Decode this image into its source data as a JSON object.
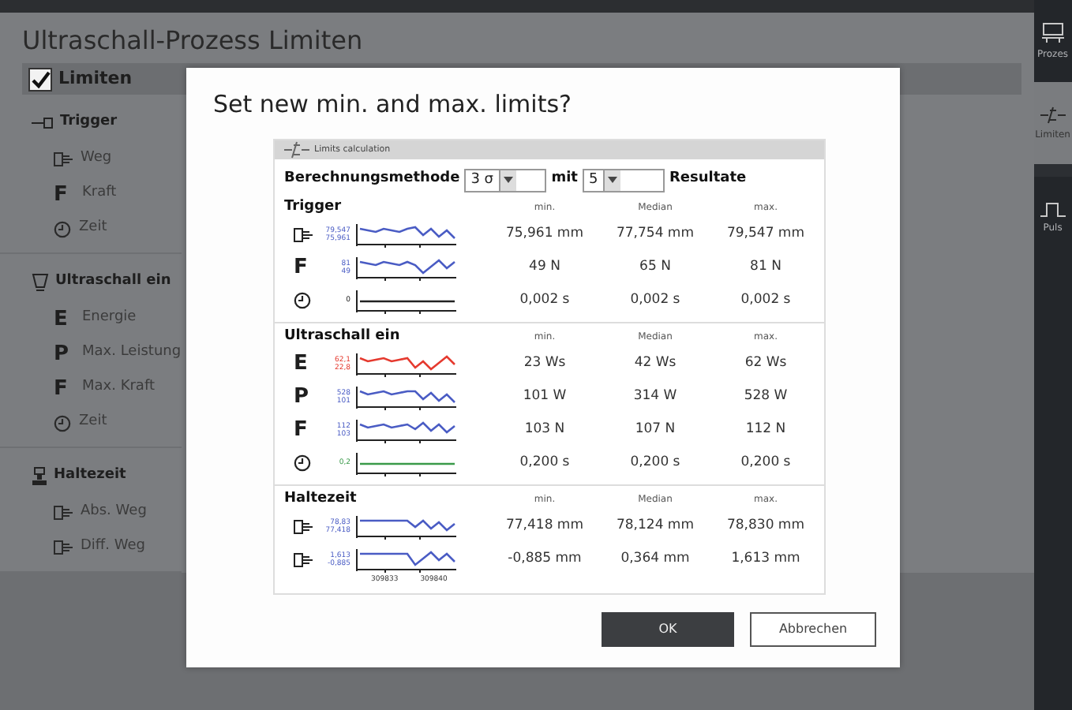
{
  "app": {
    "title": "Ultraschall-Prozess Limiten"
  },
  "sidebar": {
    "header": {
      "label": "Limiten",
      "checked": true
    },
    "sections": [
      {
        "title": "Trigger",
        "items": [
          {
            "label": "Weg",
            "kind": "distance"
          },
          {
            "label": "Kraft",
            "kind": "glyph",
            "glyph": "F"
          },
          {
            "label": "Zeit",
            "kind": "time"
          }
        ]
      },
      {
        "title": "Ultraschall ein",
        "items": [
          {
            "label": "Energie",
            "kind": "glyph",
            "glyph": "E"
          },
          {
            "label": "Max. Leistung",
            "kind": "glyph",
            "glyph": "P"
          },
          {
            "label": "Max. Kraft",
            "kind": "glyph",
            "glyph": "F"
          },
          {
            "label": "Zeit",
            "kind": "time"
          }
        ]
      },
      {
        "title": "Haltezeit",
        "items": [
          {
            "label": "Abs. Weg",
            "kind": "distance"
          },
          {
            "label": "Diff. Weg",
            "kind": "distance"
          }
        ]
      }
    ]
  },
  "rail": [
    {
      "label": "Prozes",
      "selected": false
    },
    {
      "label": "Limiten",
      "selected": true
    },
    {
      "label": "Puls",
      "selected": false
    }
  ],
  "dialog": {
    "title": "Set new min. and max. limits?",
    "panel": {
      "title": "Limits calculation",
      "method_label": "Berechnungsmethode",
      "method": "3 σ",
      "with_label": "mit",
      "count": "5",
      "results_label": "Resultate",
      "sections": [
        {
          "title": "Trigger",
          "columns": [
            "min.",
            "Median",
            "max."
          ],
          "rows": [
            {
              "kind": "distance",
              "axis_max": "79,547",
              "axis_min": "75,961",
              "color": "#4a5cc4",
              "min": "75,961 mm",
              "median": "77,754 mm",
              "max": "79,547 mm"
            },
            {
              "kind": "glyph",
              "glyph": "F",
              "axis_max": "81",
              "axis_min": "49",
              "color": "#4a5cc4",
              "min": "49 N",
              "median": "65 N",
              "max": "81 N"
            },
            {
              "kind": "time",
              "axis_max": "0",
              "color": "#222222",
              "min": "0,002 s",
              "median": "0,002 s",
              "max": "0,002 s"
            }
          ]
        },
        {
          "title": "Ultraschall ein",
          "columns": [
            "min.",
            "Median",
            "max."
          ],
          "rows": [
            {
              "kind": "glyph",
              "glyph": "E",
              "axis_max": "62,1",
              "axis_min": "22,8",
              "color": "#e53a2f",
              "min": "23 Ws",
              "median": "42 Ws",
              "max": "62 Ws"
            },
            {
              "kind": "glyph",
              "glyph": "P",
              "axis_max": "528",
              "axis_min": "101",
              "color": "#4a5cc4",
              "min": "101 W",
              "median": "314 W",
              "max": "528 W"
            },
            {
              "kind": "glyph",
              "glyph": "F",
              "axis_max": "112",
              "axis_min": "103",
              "color": "#4a5cc4",
              "min": "103 N",
              "median": "107 N",
              "max": "112 N"
            },
            {
              "kind": "time",
              "axis_max": "0,2",
              "color": "#3a9a4a",
              "min": "0,200 s",
              "median": "0,200 s",
              "max": "0,200 s"
            }
          ]
        },
        {
          "title": "Haltezeit",
          "columns": [
            "min.",
            "Median",
            "max."
          ],
          "rows": [
            {
              "kind": "distance",
              "axis_max": "78,83",
              "axis_min": "77,418",
              "color": "#4a5cc4",
              "min": "77,418 mm",
              "median": "78,124 mm",
              "max": "78,830 mm"
            },
            {
              "kind": "distance",
              "axis_max": "1,613",
              "axis_min": "-0,885",
              "color": "#4a5cc4",
              "min": "-0,885 mm",
              "median": "0,364 mm",
              "max": "1,613 mm"
            }
          ]
        }
      ],
      "x_labels": [
        "309833",
        "309840"
      ]
    },
    "buttons": [
      {
        "label": "OK",
        "kind": "primary"
      },
      {
        "label": "Abbrechen",
        "kind": "secondary"
      }
    ]
  }
}
